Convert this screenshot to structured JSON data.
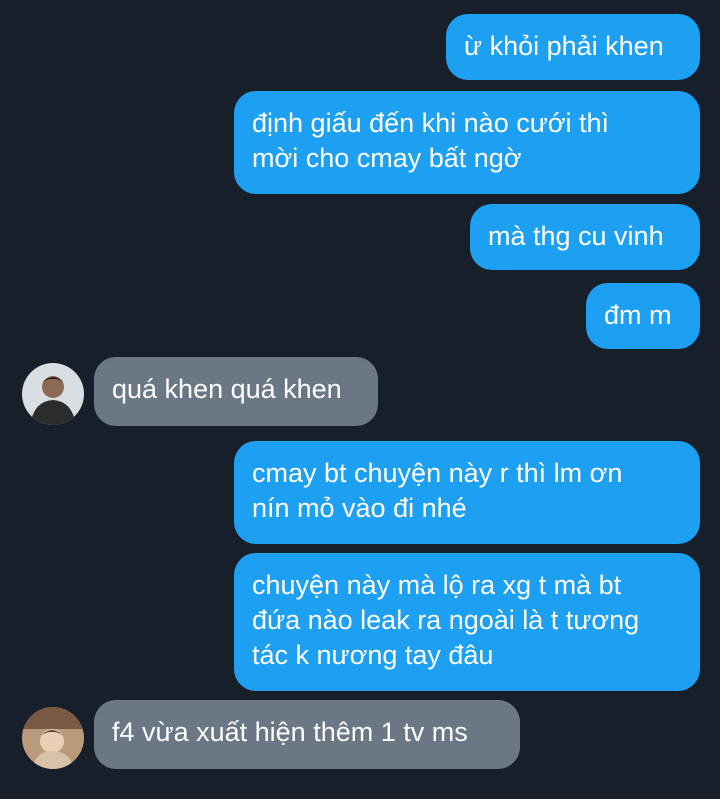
{
  "conversation": {
    "messages": [
      {
        "side": "sent",
        "text": "ừ khỏi phải khen"
      },
      {
        "side": "sent",
        "text": "định giấu đến khi nào cưới thì\nmời cho cmay bất ngờ"
      },
      {
        "side": "sent",
        "text": "mà thg cu vinh"
      },
      {
        "side": "sent",
        "text": "đm m"
      },
      {
        "side": "received",
        "text": "quá khen quá khen"
      },
      {
        "side": "sent",
        "text": "cmay bt chuyện này r thì lm ơn\nnín mỏ vào đi nhé"
      },
      {
        "side": "sent",
        "text": "chuyện này mà lộ ra xg t mà bt\nđứa nào leak ra ngoài là t tương\ntác k nương tay đâu"
      },
      {
        "side": "received",
        "text": "f4 vừa xuất hiện thêm 1 tv ms"
      }
    ]
  },
  "colors": {
    "background": "#17202a",
    "sent_bubble": "#1da0f2",
    "received_bubble": "#6b7785"
  }
}
